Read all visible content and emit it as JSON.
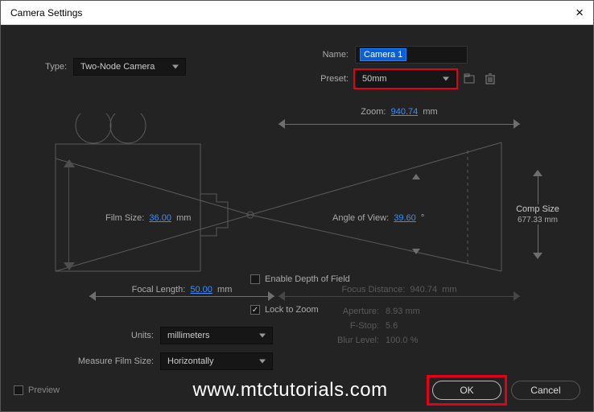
{
  "window": {
    "title": "Camera Settings"
  },
  "top": {
    "type_label": "Type:",
    "type_value": "Two-Node Camera",
    "name_label": "Name:",
    "name_value": "Camera 1",
    "preset_label": "Preset:",
    "preset_value": "50mm"
  },
  "diagram": {
    "zoom_label": "Zoom:",
    "zoom_value": "940.74",
    "zoom_unit": "mm",
    "film_size_label": "Film Size:",
    "film_size_value": "36.00",
    "film_size_unit": "mm",
    "angle_label": "Angle of View:",
    "angle_value": "39.60",
    "angle_unit": "°",
    "comp_label": "Comp Size",
    "comp_value": "677.33",
    "comp_unit": "mm",
    "focal_label": "Focal Length:",
    "focal_value": "50.00",
    "focal_unit": "mm"
  },
  "dof": {
    "enable_label": "Enable Depth of Field",
    "enable_checked": false,
    "focus_dist_label": "Focus Distance:",
    "focus_dist_value": "940.74",
    "focus_dist_unit": "mm",
    "lock_label": "Lock to Zoom",
    "lock_checked": true,
    "aperture_label": "Aperture:",
    "aperture_value": "8.93",
    "aperture_unit": "mm",
    "fstop_label": "F-Stop:",
    "fstop_value": "5.6",
    "blur_label": "Blur Level:",
    "blur_value": "100.0",
    "blur_unit": "%"
  },
  "units": {
    "units_label": "Units:",
    "units_value": "millimeters",
    "measure_label": "Measure Film Size:",
    "measure_value": "Horizontally"
  },
  "footer": {
    "preview_label": "Preview",
    "watermark": "www.mtctutorials.com",
    "ok": "OK",
    "cancel": "Cancel"
  }
}
